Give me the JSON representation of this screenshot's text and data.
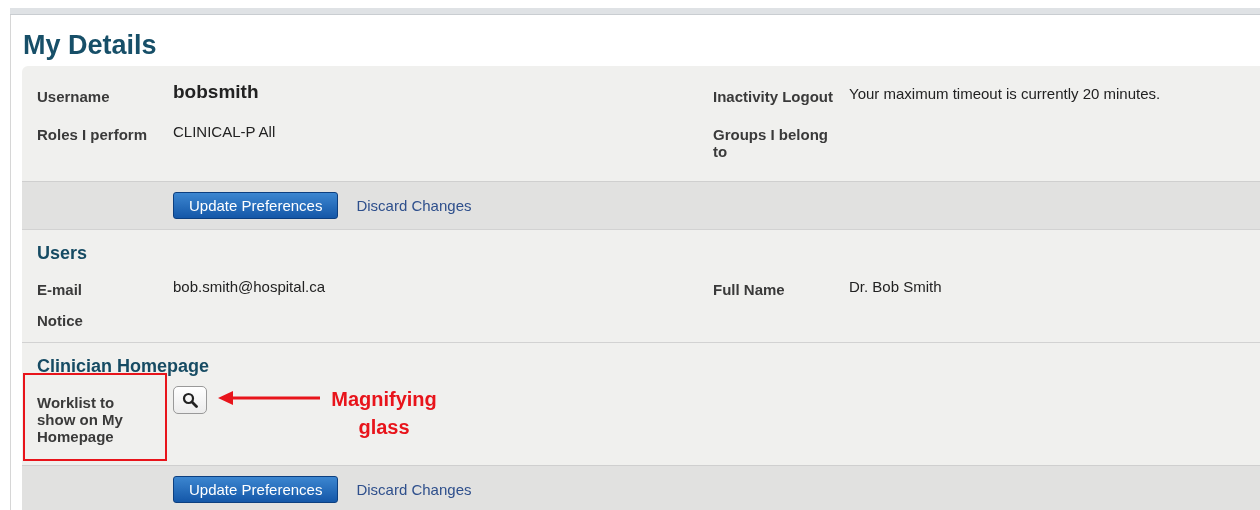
{
  "title": "My Details",
  "sections": [
    {
      "rows": [
        [
          {
            "kind": "strong",
            "label": "Username",
            "value": "bobsmith"
          },
          {
            "kind": "text",
            "label": "Inactivity Logout",
            "value": "Your maximum timeout is currently 20 minutes."
          }
        ],
        [
          {
            "kind": "text",
            "label": "Roles I perform",
            "value": "CLINICAL-P All"
          },
          {
            "kind": "text",
            "label": "Groups I belong to"
          }
        ]
      ],
      "actions": {
        "primary": "Update Preferences",
        "link": "Discard Changes"
      }
    },
    {
      "heading": "Users",
      "rows": [
        [
          {
            "kind": "text",
            "label": "E-mail",
            "value": "bob.smith@hospital.ca"
          },
          {
            "kind": "text",
            "label": "Full Name",
            "value": "Dr. Bob Smith"
          }
        ],
        [
          {
            "kind": "text",
            "label": "Notice"
          }
        ]
      ]
    },
    {
      "heading": "Clinician Homepage",
      "rows": [
        [
          {
            "kind": "lookup",
            "label": "Worklist to show on My Homepage",
            "highlighted": true
          }
        ]
      ],
      "annotation": {
        "text": "Magnifying glass"
      },
      "actions": {
        "primary": "Update Preferences",
        "link": "Discard Changes"
      }
    }
  ]
}
